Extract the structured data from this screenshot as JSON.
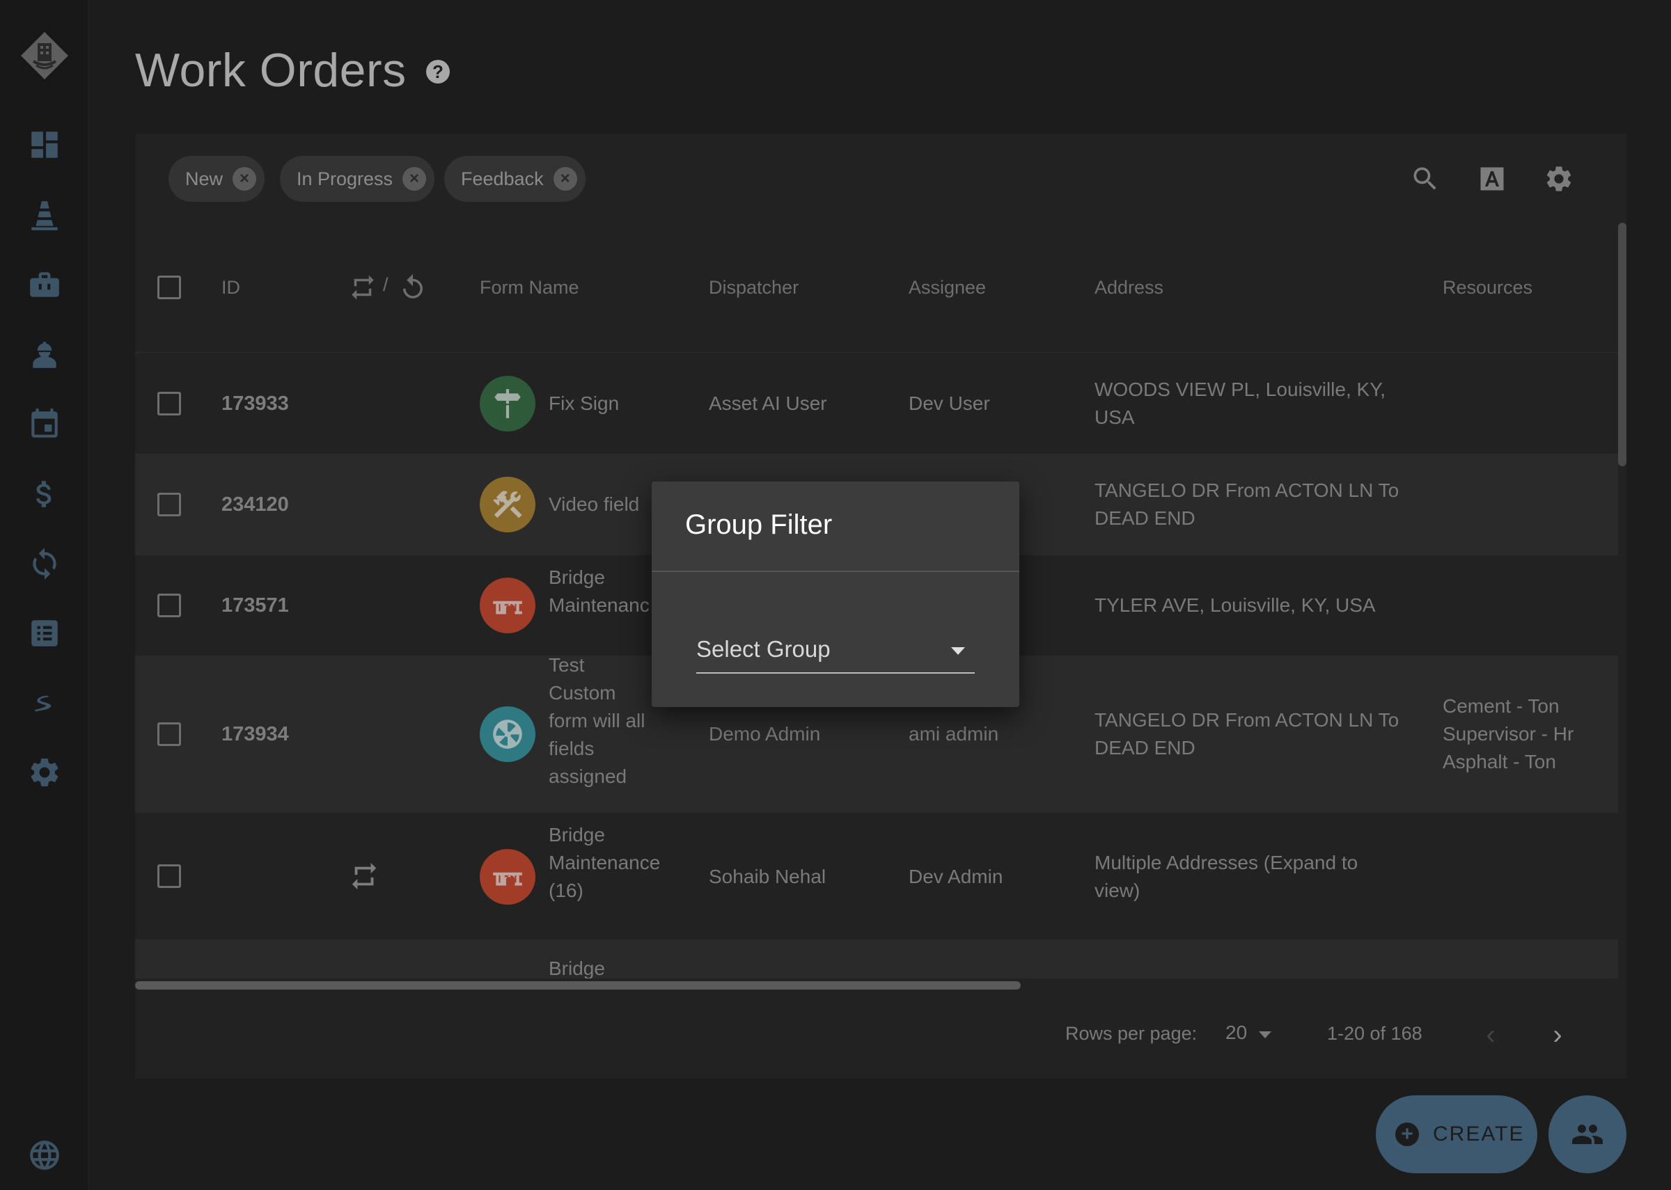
{
  "page": {
    "title": "Work Orders"
  },
  "filters": [
    {
      "label": "New"
    },
    {
      "label": "In Progress"
    },
    {
      "label": "Feedback"
    }
  ],
  "table": {
    "headers": {
      "id": "ID",
      "recurring_separator": "/",
      "form_name": "Form Name",
      "dispatcher": "Dispatcher",
      "assignee": "Assignee",
      "address": "Address",
      "resources": "Resources"
    },
    "rows": [
      {
        "id": "173933",
        "form_name": "Fix Sign",
        "dispatcher": "Asset AI User",
        "assignee": "Dev User",
        "address": "WOODS VIEW PL, Louisville, KY, USA",
        "resources": ""
      },
      {
        "id": "234120",
        "form_name": "Video field",
        "dispatcher": "",
        "assignee": "",
        "address": "TANGELO DR From ACTON LN To DEAD END",
        "resources": ""
      },
      {
        "id": "173571",
        "form_name": "Bridge Maintenanc",
        "dispatcher": "",
        "assignee": "",
        "address": "TYLER AVE, Louisville, KY, USA",
        "resources": ""
      },
      {
        "id": "173934",
        "form_name": "Test Custom form will all fields assigned",
        "dispatcher": "Demo Admin",
        "assignee": "ami admin",
        "address": "TANGELO DR From ACTON LN To DEAD END",
        "resources": "Cement - Ton Supervisor - Hr Asphalt - Ton"
      },
      {
        "id": "",
        "form_name": "Bridge Maintenance (16)",
        "dispatcher": "Sohaib Nehal",
        "assignee": "Dev Admin",
        "address": "Multiple Addresses (Expand to view)",
        "resources": ""
      },
      {
        "id": "",
        "form_name": "Bridge",
        "dispatcher": "",
        "assignee": "",
        "address": "",
        "resources": ""
      }
    ]
  },
  "pagination": {
    "rows_per_page_label": "Rows per page:",
    "rows_per_page": "20",
    "range": "1-20 of 168"
  },
  "actions": {
    "create_label": "CREATE"
  },
  "dialog": {
    "title": "Group Filter",
    "select_label": "Select Group"
  },
  "colors": {
    "background": "#1c1c1c",
    "accent": "#3c5970",
    "sign_icon": "#2f5a3a",
    "video_icon": "#8a6a2a",
    "bridge_icon": "#a13c28",
    "custom_icon": "#2f7a82"
  }
}
